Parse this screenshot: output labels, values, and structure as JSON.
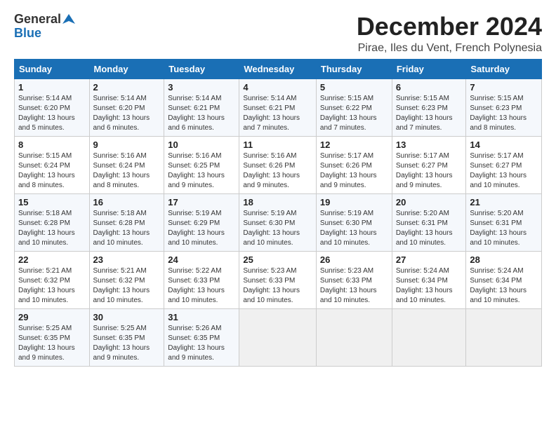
{
  "logo": {
    "general": "General",
    "blue": "Blue"
  },
  "title": "December 2024",
  "location": "Pirae, Iles du Vent, French Polynesia",
  "days_of_week": [
    "Sunday",
    "Monday",
    "Tuesday",
    "Wednesday",
    "Thursday",
    "Friday",
    "Saturday"
  ],
  "weeks": [
    [
      {
        "day": "1",
        "sunrise": "5:14 AM",
        "sunset": "6:20 PM",
        "daylight": "13 hours and 5 minutes."
      },
      {
        "day": "2",
        "sunrise": "5:14 AM",
        "sunset": "6:20 PM",
        "daylight": "13 hours and 6 minutes."
      },
      {
        "day": "3",
        "sunrise": "5:14 AM",
        "sunset": "6:21 PM",
        "daylight": "13 hours and 6 minutes."
      },
      {
        "day": "4",
        "sunrise": "5:14 AM",
        "sunset": "6:21 PM",
        "daylight": "13 hours and 7 minutes."
      },
      {
        "day": "5",
        "sunrise": "5:15 AM",
        "sunset": "6:22 PM",
        "daylight": "13 hours and 7 minutes."
      },
      {
        "day": "6",
        "sunrise": "5:15 AM",
        "sunset": "6:23 PM",
        "daylight": "13 hours and 7 minutes."
      },
      {
        "day": "7",
        "sunrise": "5:15 AM",
        "sunset": "6:23 PM",
        "daylight": "13 hours and 8 minutes."
      }
    ],
    [
      {
        "day": "8",
        "sunrise": "5:15 AM",
        "sunset": "6:24 PM",
        "daylight": "13 hours and 8 minutes."
      },
      {
        "day": "9",
        "sunrise": "5:16 AM",
        "sunset": "6:24 PM",
        "daylight": "13 hours and 8 minutes."
      },
      {
        "day": "10",
        "sunrise": "5:16 AM",
        "sunset": "6:25 PM",
        "daylight": "13 hours and 9 minutes."
      },
      {
        "day": "11",
        "sunrise": "5:16 AM",
        "sunset": "6:26 PM",
        "daylight": "13 hours and 9 minutes."
      },
      {
        "day": "12",
        "sunrise": "5:17 AM",
        "sunset": "6:26 PM",
        "daylight": "13 hours and 9 minutes."
      },
      {
        "day": "13",
        "sunrise": "5:17 AM",
        "sunset": "6:27 PM",
        "daylight": "13 hours and 9 minutes."
      },
      {
        "day": "14",
        "sunrise": "5:17 AM",
        "sunset": "6:27 PM",
        "daylight": "13 hours and 10 minutes."
      }
    ],
    [
      {
        "day": "15",
        "sunrise": "5:18 AM",
        "sunset": "6:28 PM",
        "daylight": "13 hours and 10 minutes."
      },
      {
        "day": "16",
        "sunrise": "5:18 AM",
        "sunset": "6:28 PM",
        "daylight": "13 hours and 10 minutes."
      },
      {
        "day": "17",
        "sunrise": "5:19 AM",
        "sunset": "6:29 PM",
        "daylight": "13 hours and 10 minutes."
      },
      {
        "day": "18",
        "sunrise": "5:19 AM",
        "sunset": "6:30 PM",
        "daylight": "13 hours and 10 minutes."
      },
      {
        "day": "19",
        "sunrise": "5:19 AM",
        "sunset": "6:30 PM",
        "daylight": "13 hours and 10 minutes."
      },
      {
        "day": "20",
        "sunrise": "5:20 AM",
        "sunset": "6:31 PM",
        "daylight": "13 hours and 10 minutes."
      },
      {
        "day": "21",
        "sunrise": "5:20 AM",
        "sunset": "6:31 PM",
        "daylight": "13 hours and 10 minutes."
      }
    ],
    [
      {
        "day": "22",
        "sunrise": "5:21 AM",
        "sunset": "6:32 PM",
        "daylight": "13 hours and 10 minutes."
      },
      {
        "day": "23",
        "sunrise": "5:21 AM",
        "sunset": "6:32 PM",
        "daylight": "13 hours and 10 minutes."
      },
      {
        "day": "24",
        "sunrise": "5:22 AM",
        "sunset": "6:33 PM",
        "daylight": "13 hours and 10 minutes."
      },
      {
        "day": "25",
        "sunrise": "5:23 AM",
        "sunset": "6:33 PM",
        "daylight": "13 hours and 10 minutes."
      },
      {
        "day": "26",
        "sunrise": "5:23 AM",
        "sunset": "6:33 PM",
        "daylight": "13 hours and 10 minutes."
      },
      {
        "day": "27",
        "sunrise": "5:24 AM",
        "sunset": "6:34 PM",
        "daylight": "13 hours and 10 minutes."
      },
      {
        "day": "28",
        "sunrise": "5:24 AM",
        "sunset": "6:34 PM",
        "daylight": "13 hours and 10 minutes."
      }
    ],
    [
      {
        "day": "29",
        "sunrise": "5:25 AM",
        "sunset": "6:35 PM",
        "daylight": "13 hours and 9 minutes."
      },
      {
        "day": "30",
        "sunrise": "5:25 AM",
        "sunset": "6:35 PM",
        "daylight": "13 hours and 9 minutes."
      },
      {
        "day": "31",
        "sunrise": "5:26 AM",
        "sunset": "6:35 PM",
        "daylight": "13 hours and 9 minutes."
      },
      null,
      null,
      null,
      null
    ]
  ]
}
